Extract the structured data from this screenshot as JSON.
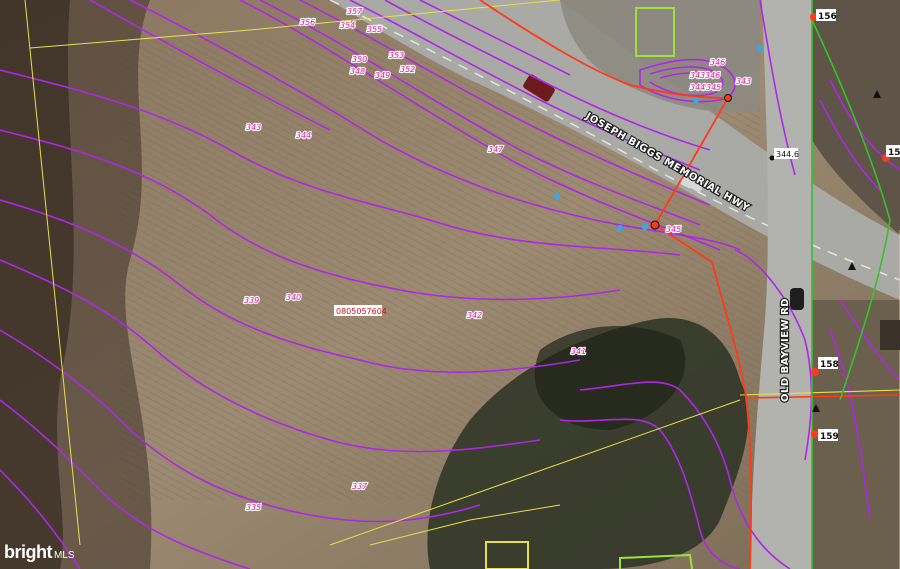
{
  "road_labels": {
    "highway": "JOSEPH BIGGS MEMORIAL HWY",
    "cross_road": "OLD BAYVIEW RD"
  },
  "parcel_id": "0805057604",
  "spot_elevation": "344.6",
  "node_labels": [
    "156",
    "158",
    "159",
    "15"
  ],
  "contour_labels": [
    "356",
    "354",
    "355",
    "357",
    "350",
    "353",
    "352",
    "348",
    "349",
    "343",
    "344",
    "345",
    "346",
    "347",
    "345",
    "339",
    "340",
    "342",
    "341",
    "337",
    "335",
    "343",
    "346",
    "343",
    "344",
    "345"
  ],
  "watermark": {
    "brand": "bright",
    "suffix": "MLS"
  },
  "colors": {
    "contour": "#b126e6",
    "parcel_line": "#e6e04a",
    "utility_red": "#ff3a1a",
    "utility_green": "#36c22a",
    "structure": "#9be23c"
  }
}
